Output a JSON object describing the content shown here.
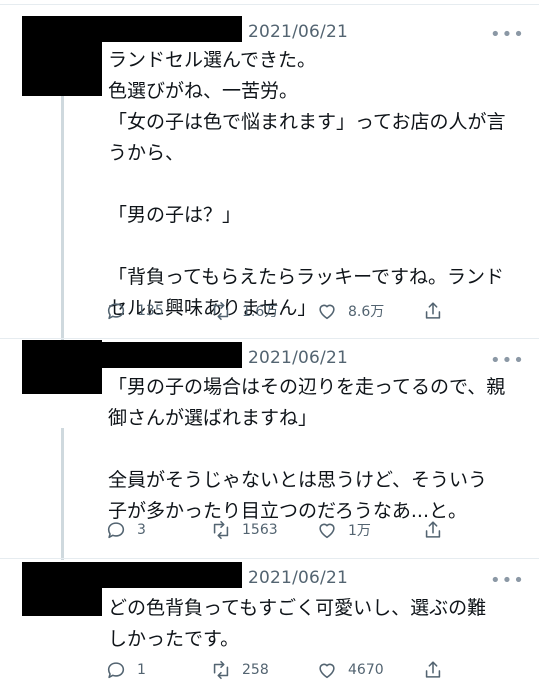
{
  "tweets": [
    {
      "date": "2021/06/21",
      "more": "•••",
      "paragraphs": [
        "ランドセル選んできた。\n色選びがね、一苦労。\n「女の子は色で悩まれます」ってお店の人が言\nうから、",
        "「男の子は？」",
        "「背負ってもらえたらラッキーですね。ランド\nセルに興味ありません」"
      ],
      "replies": "135",
      "retweets": "1.6万",
      "likes": "8.6万"
    },
    {
      "date": "2021/06/21",
      "more": "•••",
      "paragraphs": [
        "「男の子の場合はその辺りを走ってるので、親\n御さんが選ばれますね」",
        "全員がそうじゃないとは思うけど、そういう\n子が多かったり目立つのだろうなあ...と。"
      ],
      "replies": "3",
      "retweets": "1563",
      "likes": "1万"
    },
    {
      "date": "2021/06/21",
      "more": "•••",
      "paragraphs": [
        "どの色背負ってもすごく可愛いし、選ぶの難\nしかったです。"
      ],
      "replies": "1",
      "retweets": "258",
      "likes": "4670"
    }
  ],
  "icons": [
    "reply-icon",
    "retweet-icon",
    "like-icon",
    "share-icon"
  ],
  "colors": {
    "text": "#0f1419",
    "secondary": "#536471",
    "thread": "#cfd9de",
    "mask": "#000000"
  }
}
